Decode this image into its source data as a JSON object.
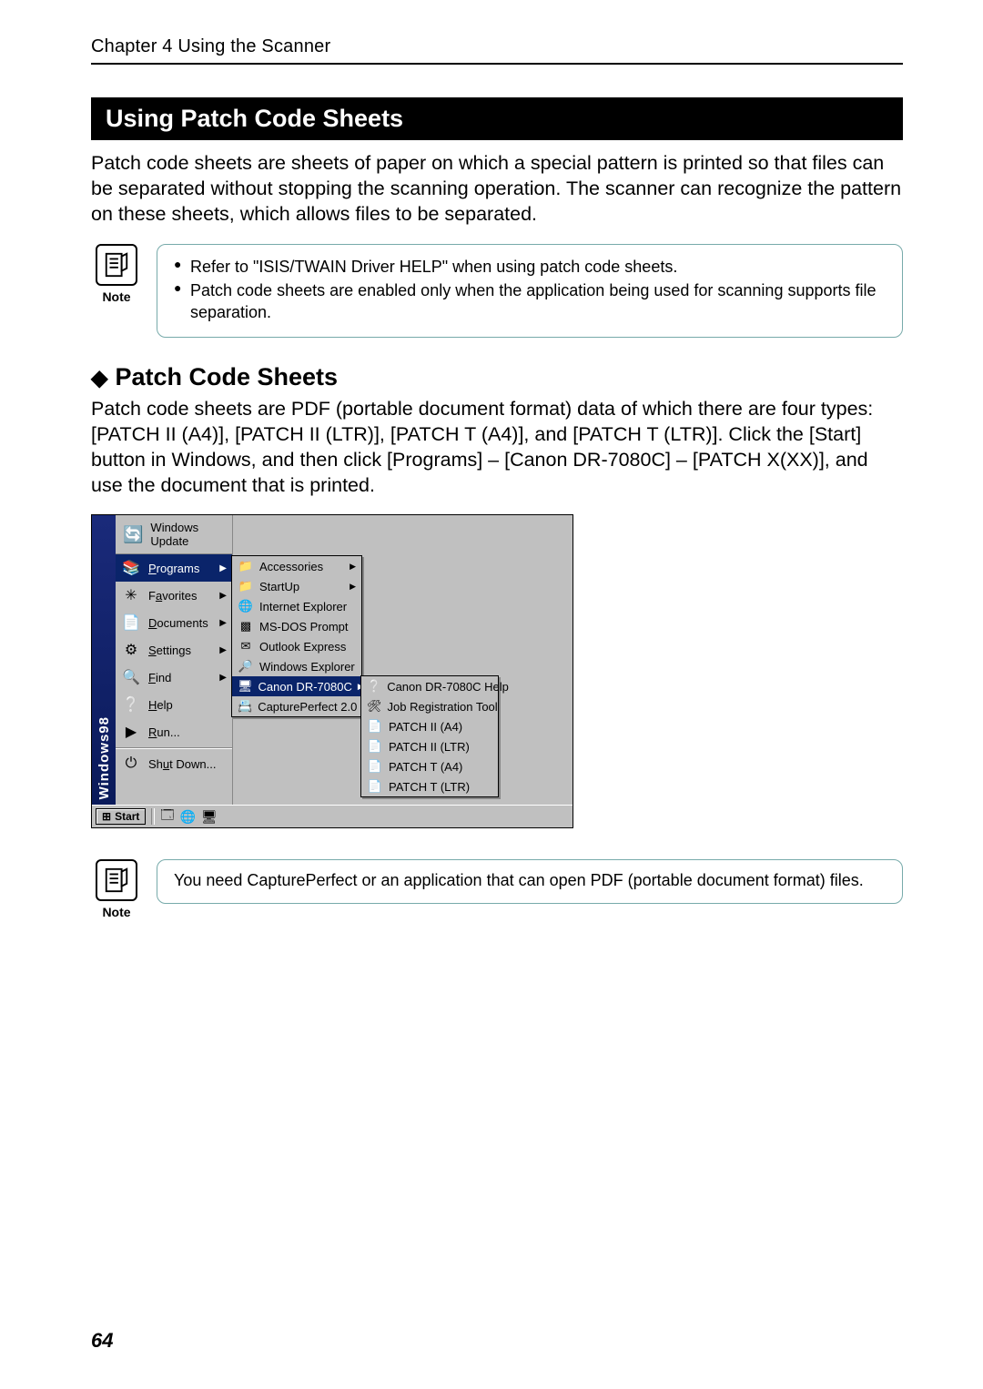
{
  "chapter_header": "Chapter 4    Using the Scanner",
  "section_title": "Using Patch Code Sheets",
  "intro_para": "Patch code sheets are sheets of paper on which a special pattern is printed so that files can be separated without stopping the scanning operation. The scanner can recognize the pattern on these sheets, which allows files to be separated.",
  "note_label": "Note",
  "note1_items": [
    "Refer to \"ISIS/TWAIN Driver HELP\" when using patch code sheets.",
    "Patch code sheets are enabled only when the application being used for scanning supports file separation."
  ],
  "subheading": "Patch Code Sheets",
  "sub_para": "Patch code sheets are PDF (portable document format) data of which there are four types: [PATCH II (A4)], [PATCH II (LTR)], [PATCH T (A4)], and [PATCH T (LTR)]. Click the [Start] button in Windows, and then click [Programs] – [Canon DR-7080C] – [PATCH X(XX)], and use the document that is printed.",
  "note2_text": "You need CapturePerfect or an application that can open PDF (portable document format) files.",
  "page_number": "64",
  "win": {
    "sidebar": "Windows98",
    "update": "Windows Update",
    "start_items": [
      {
        "label": "Programs",
        "hl": true,
        "arrow": true,
        "ak": "P",
        "icon": "📚"
      },
      {
        "label": "Favorites",
        "hl": false,
        "arrow": true,
        "ak": "a",
        "icon": "✳"
      },
      {
        "label": "Documents",
        "hl": false,
        "arrow": true,
        "ak": "D",
        "icon": "📄"
      },
      {
        "label": "Settings",
        "hl": false,
        "arrow": true,
        "ak": "S",
        "icon": "⚙"
      },
      {
        "label": "Find",
        "hl": false,
        "arrow": true,
        "ak": "F",
        "icon": "🔍"
      },
      {
        "label": "Help",
        "hl": false,
        "arrow": false,
        "ak": "H",
        "icon": "❔"
      },
      {
        "label": "Run...",
        "hl": false,
        "arrow": false,
        "ak": "R",
        "icon": "▶"
      }
    ],
    "shutdown": {
      "label": "Shut Down...",
      "ak": "u",
      "icon": "⏻"
    },
    "sub1": [
      {
        "label": "Accessories",
        "arrow": true,
        "icon": "📁"
      },
      {
        "label": "StartUp",
        "arrow": true,
        "icon": "📁"
      },
      {
        "label": "Internet Explorer",
        "arrow": false,
        "icon": "🌐"
      },
      {
        "label": "MS-DOS Prompt",
        "arrow": false,
        "icon": "▩"
      },
      {
        "label": "Outlook Express",
        "arrow": false,
        "icon": "✉"
      },
      {
        "label": "Windows Explorer",
        "arrow": false,
        "icon": "🔎"
      },
      {
        "label": "Canon DR-7080C",
        "arrow": true,
        "icon": "🖥",
        "hl": true
      },
      {
        "label": "CapturePerfect 2.0",
        "arrow": false,
        "icon": "📇"
      }
    ],
    "sub2": [
      {
        "label": "Canon DR-7080C Help",
        "icon": "❔"
      },
      {
        "label": "Job Registration Tool",
        "icon": "🛠"
      },
      {
        "label": "PATCH II (A4)",
        "icon": "📄"
      },
      {
        "label": "PATCH II (LTR)",
        "icon": "📄"
      },
      {
        "label": "PATCH T (A4)",
        "icon": "📄"
      },
      {
        "label": "PATCH T (LTR)",
        "icon": "📄"
      }
    ],
    "start_button": "Start"
  }
}
